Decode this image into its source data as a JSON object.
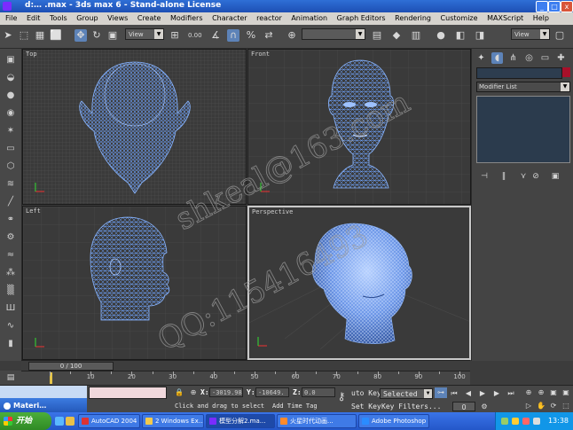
{
  "window": {
    "title": "d:… .max - 3ds max 6 - Stand-alone License",
    "min_label": "_",
    "max_label": "□",
    "close_label": "x"
  },
  "menu": [
    "File",
    "Edit",
    "Tools",
    "Group",
    "Views",
    "Create",
    "Modifiers",
    "Character",
    "reactor",
    "Animation",
    "Graph Editors",
    "Rendering",
    "Customize",
    "MAXScript",
    "Help"
  ],
  "toolbar": {
    "view_dropdown": "View",
    "view_dropdown2": "View",
    "spinner_label": "3",
    "spinner_value": "0.00"
  },
  "viewports": {
    "top": "Top",
    "front": "Front",
    "left": "Left",
    "perspective": "Perspective"
  },
  "command_panel": {
    "modifier_list": "Modifier List"
  },
  "timeline": {
    "frame_display": "0 / 100",
    "ticks": [
      "10",
      "20",
      "30",
      "40",
      "50",
      "60",
      "70",
      "80",
      "90",
      "100"
    ]
  },
  "status": {
    "material_editor": "Materi…",
    "x_label": "X:",
    "x_value": "-3019.98",
    "y_label": "Y:",
    "y_value": "-10649.",
    "z_label": "Z:",
    "z_value": "0.0",
    "prompt": "Click and drag to select",
    "add_time_tag": "Add Time Tag",
    "auto_key": "uto Key",
    "set_key": "Set Key",
    "key_filters": "Key Filters...",
    "selected": "Selected",
    "frame_value": "0"
  },
  "taskbar": {
    "start": "开始",
    "tasks": [
      "AutoCAD 2004 ...",
      "2 Windows Ex...",
      "模型分解2.ma...",
      "火星时代动画...",
      "Adobe Photoshop"
    ],
    "clock": "13:38"
  },
  "watermark": {
    "line1": "shkeal@163.com",
    "line2": "QQ:115416493"
  },
  "colors": {
    "wire": "#6fa4ff",
    "accent": "#a8102a"
  }
}
